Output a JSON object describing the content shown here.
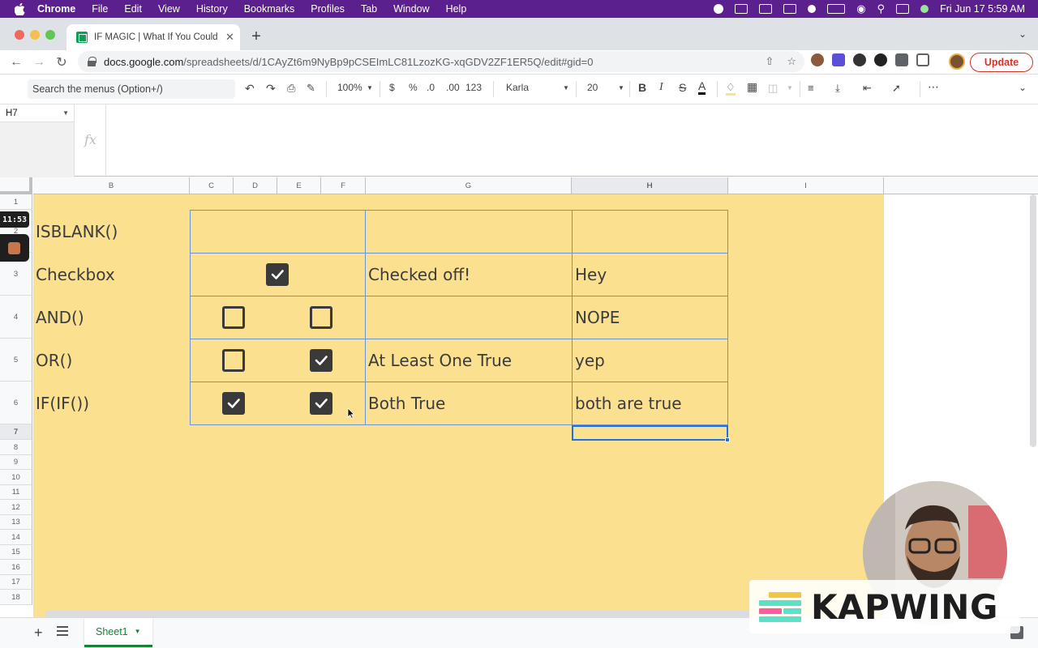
{
  "menubar": {
    "app": "Chrome",
    "items": [
      "File",
      "Edit",
      "View",
      "History",
      "Bookmarks",
      "Profiles",
      "Tab",
      "Window",
      "Help"
    ],
    "datetime": "Fri Jun 17  5:59 AM"
  },
  "browser": {
    "tab_title": "IF MAGIC | What If You Could P",
    "url_host": "docs.google.com",
    "url_path": "/spreadsheets/d/1CAyZt6m9NyBp9pCSEImLC81LzozKG-xqGDV2ZF1ER5Q/edit#gid=0",
    "update_label": "Update"
  },
  "toolbar": {
    "search_placeholder": "Search the menus (Option+/)",
    "zoom": "100%",
    "currency": "$",
    "percent": "%",
    "dec_decrease": ".0",
    "dec_increase": ".00",
    "number_format": "123",
    "font": "Karla",
    "font_size": "20",
    "bold": "B",
    "italic": "I",
    "strike": "S",
    "text_color": "A",
    "more": "⋯"
  },
  "formula_bar": {
    "cell_ref": "H7",
    "fx_label": "fx",
    "value": ""
  },
  "grid": {
    "columns": [
      "B",
      "C",
      "D",
      "E",
      "F",
      "G",
      "H",
      "I"
    ],
    "selected_column": "H",
    "rows": [
      "1",
      "2",
      "3",
      "4",
      "5",
      "6",
      "7",
      "8",
      "9",
      "10",
      "11",
      "12",
      "13",
      "14",
      "15",
      "16",
      "17",
      "18"
    ],
    "selected_row": "7",
    "table_rows": [
      {
        "label": "ISBLANK()",
        "c": null,
        "e": null,
        "g": "",
        "h": ""
      },
      {
        "label": "Checkbox",
        "c": true,
        "e": null,
        "g": "Checked off!",
        "h": "Hey"
      },
      {
        "label": "AND()",
        "c": false,
        "e": false,
        "g": "",
        "h": "NOPE"
      },
      {
        "label": "OR()",
        "c": false,
        "e": true,
        "g": "At Least One True",
        "h": "yep"
      },
      {
        "label": "IF(IF())",
        "c": true,
        "e": true,
        "g": "Both True",
        "h": "both are true"
      }
    ],
    "colors": {
      "sheet_fill": "#fbe08f",
      "border": "#6a92d4",
      "selection": "#1a73e8"
    }
  },
  "overlay": {
    "timer": "11:53",
    "brand": "KAPWING"
  },
  "sheets": {
    "active_tab": "Sheet1"
  }
}
